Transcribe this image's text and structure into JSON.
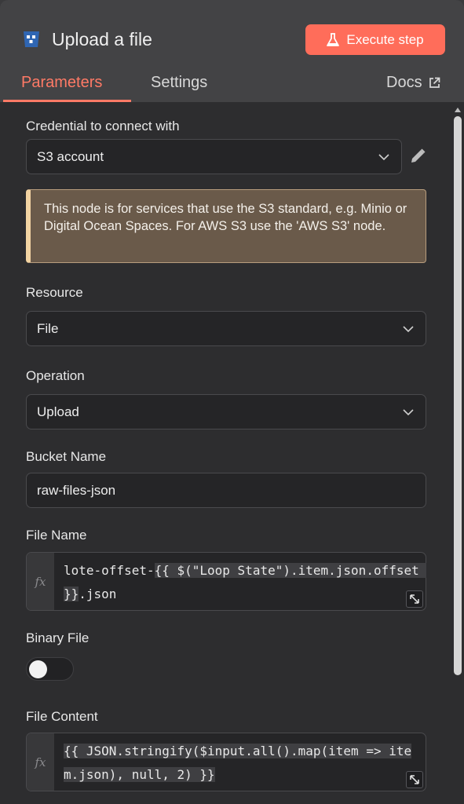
{
  "header": {
    "title": "Upload a file",
    "execute_label": "Execute step"
  },
  "tabs": {
    "parameters": "Parameters",
    "settings": "Settings",
    "docs": "Docs"
  },
  "credential": {
    "label": "Credential to connect with",
    "value": "S3 account"
  },
  "notice": "This node is for services that use the S3 standard, e.g. Minio or Digital Ocean Spaces. For AWS S3 use the 'AWS S3' node.",
  "resource": {
    "label": "Resource",
    "value": "File"
  },
  "operation": {
    "label": "Operation",
    "value": "Upload"
  },
  "bucket": {
    "label": "Bucket Name",
    "value": "raw-files-json"
  },
  "file_name": {
    "label": "File Name",
    "prefix": "lote-offset-",
    "expression": "{{ $(\"Loop State\").item.json.offset }}",
    "suffix": ".json"
  },
  "binary_file": {
    "label": "Binary File",
    "enabled": false
  },
  "file_content": {
    "label": "File Content",
    "expression": "{{ JSON.stringify($input.all().map(item => item.json), null, 2) }}"
  },
  "fx_label": "fx",
  "icons": {
    "node": "s3-bucket-icon",
    "execute": "flask-icon",
    "docs": "external-link-icon",
    "chevron": "chevron-down-icon",
    "edit": "pencil-icon",
    "expand": "expand-icon"
  },
  "colors": {
    "accent": "#ff6d5a",
    "tab_active": "#ff7a66",
    "notice_bg": "#6a5a4a",
    "notice_border": "#f2d3a2"
  }
}
